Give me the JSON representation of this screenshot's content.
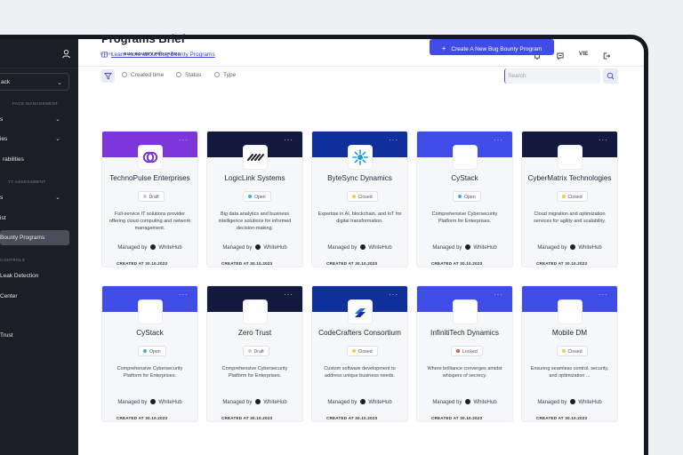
{
  "sidebar": {
    "select_value": "ack",
    "sections": [
      {
        "label": "PACE MANAGEMENT"
      },
      {
        "label": "TY ASSESSMENT"
      },
      {
        "label": "CONTROLS"
      }
    ],
    "items": [
      {
        "label": "s",
        "chevron": true
      },
      {
        "label": "ies",
        "chevron": true
      },
      {
        "label": "rabilities",
        "chevron": false
      },
      {
        "label": "s",
        "chevron": true
      },
      {
        "label": "ist",
        "chevron": false
      },
      {
        "label": "Bounty Programs",
        "chevron": false,
        "active": true
      },
      {
        "label": "Leak Detection",
        "chevron": false
      },
      {
        "label": "Center",
        "chevron": false
      },
      {
        "label": "Trust",
        "chevron": false
      }
    ]
  },
  "topbar": {
    "breadcrumb_home": "HOME",
    "breadcrumb_sep": "/",
    "breadcrumb_current": "BUG BOUNTY PROGRAMS",
    "lang": "VIE"
  },
  "header": {
    "title": "Programs Brief",
    "learn_more": "Learn more about Bug Bounty Programs",
    "create_button": "Create A New Bug Bounty Program",
    "create_plus": "+"
  },
  "filters": {
    "created_time": "Created time",
    "status": "Status",
    "type": "Type",
    "search_placeholder": "Search"
  },
  "colors": {
    "accent": "#3f4ce6",
    "status_draft": "#c9ccd4",
    "status_open": "#4ea7e8",
    "status_closed": "#f2c94c",
    "status_locked": "#e5534b"
  },
  "cards": [
    {
      "name": "TechnoPulse Enterprises",
      "status": "Draft",
      "status_color": "#c9ccd4",
      "banner": "#7b35d9",
      "logo": "techno",
      "desc": "Full-service IT solutions provider offering cloud computing and network management.",
      "managed_label": "Managed by",
      "managed_by": "WhiteHub",
      "created": "CREATED AT 30.10.2023",
      "dots": "···"
    },
    {
      "name": "LogicLink Systems",
      "status": "Open",
      "status_color": "#4ea7e8",
      "banner": "#141a3d",
      "logo": "logic",
      "desc": "Big data analytics and business intelligence solutions for informed decision-making.",
      "managed_label": "Managed by",
      "managed_by": "WhiteHub",
      "created": "CREATED AT 30.10.2023",
      "dots": "···"
    },
    {
      "name": "ByteSync Dynamics",
      "status": "Closed",
      "status_color": "#f2c94c",
      "banner": "#0f2f9a",
      "logo": "byte",
      "desc": "Expertise in AI, blockchain, and IoT for digital transformation.",
      "managed_label": "Managed by",
      "managed_by": "WhiteHub",
      "created": "CREATED AT 30.10.2023",
      "dots": "···"
    },
    {
      "name": "CyStack",
      "status": "Open",
      "status_color": "#4ea7e8",
      "banner": "#3f4ce6",
      "logo": "blank",
      "desc": "Comprehensive Cybersecurity Platform for Enterprises.",
      "managed_label": "Managed by",
      "managed_by": "WhiteHub",
      "created": "CREATED AT 30.10.2023",
      "dots": "···"
    },
    {
      "name": "CyberMatrix Technologies",
      "status": "Closed",
      "status_color": "#f2c94c",
      "banner": "#141a3d",
      "logo": "blank",
      "desc": "Cloud migration and optimization services for agility and scalability.",
      "managed_label": "Managed by",
      "managed_by": "WhiteHub",
      "created": "CREATED AT 30.10.2023",
      "dots": "···"
    },
    {
      "name": "CyStack",
      "status": "Open",
      "status_color": "#4ea7e8",
      "banner": "#3f4ce6",
      "logo": "blank",
      "desc": "Comprehensive Cybersecurity Platform for Enterprises.",
      "managed_label": "Managed by",
      "managed_by": "WhiteHub",
      "created": "CREATED AT 30.10.2023",
      "dots": "···"
    },
    {
      "name": "Zero Trust",
      "status": "Draft",
      "status_color": "#c9ccd4",
      "banner": "#141a3d",
      "logo": "blank",
      "desc": "Comprehensive Cybersecurity Platform for Enterprises.",
      "managed_label": "Managed by",
      "managed_by": "WhiteHub",
      "created": "CREATED AT 30.10.2023",
      "dots": "···"
    },
    {
      "name": "CodeCrafters Consortium",
      "status": "Closed",
      "status_color": "#f2c94c",
      "banner": "#0f2f9a",
      "logo": "code",
      "desc": "Custom software development to address unique business needs.",
      "managed_label": "Managed by",
      "managed_by": "WhiteHub",
      "created": "CREATED AT 30.10.2023",
      "dots": "···"
    },
    {
      "name": "InfinitiTech Dynamics",
      "status": "Locked",
      "status_color": "#e5534b",
      "banner": "#3f4ce6",
      "logo": "blank",
      "desc": "Where brilliance converges amidst whispers of secrecy.",
      "managed_label": "Managed by",
      "managed_by": "WhiteHub",
      "created": "CREATED AT 30.10.2023",
      "dots": "···"
    },
    {
      "name": "Mobile DM",
      "status": "Closed",
      "status_color": "#f2c94c",
      "banner": "#3f4ce6",
      "logo": "blank",
      "desc": "Ensuring seamless control, security, and optimization ...",
      "managed_label": "Managed by",
      "managed_by": "WhiteHub",
      "created": "CREATED AT 30.10.2023",
      "dots": "···"
    }
  ]
}
